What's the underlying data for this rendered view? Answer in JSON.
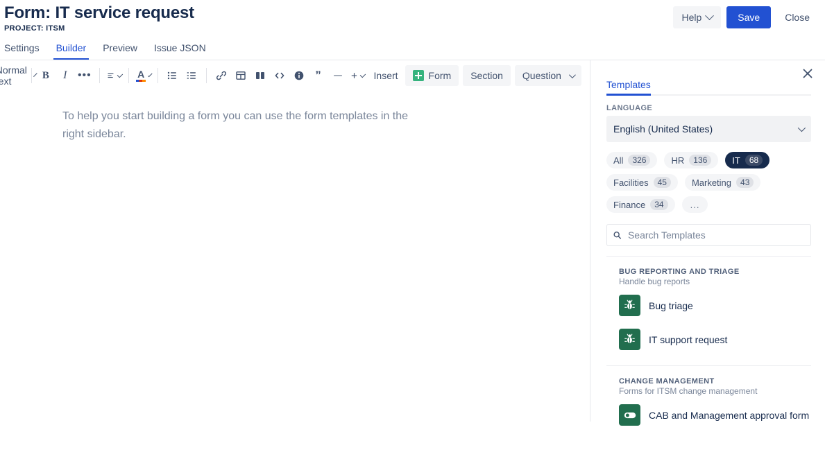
{
  "header": {
    "title": "Form: IT service request",
    "project": "PROJECT: ITSM",
    "help_label": "Help",
    "save_label": "Save",
    "close_label": "Close",
    "primary_color": "#2251d2"
  },
  "main_tabs": [
    {
      "label": "Settings",
      "active": false
    },
    {
      "label": "Builder",
      "active": true
    },
    {
      "label": "Preview",
      "active": false
    },
    {
      "label": "Issue JSON",
      "active": false
    }
  ],
  "toolbar": {
    "text_style": "Normal text",
    "bold": "B",
    "italic": "I",
    "more_marks": "•••",
    "align": "align-left",
    "text_color_glyph": "A",
    "bullet_list": "bullet-list",
    "numbered_list": "numbered-list",
    "link": "link",
    "table": "table",
    "layout": "columns-layout",
    "code": "code-snippet",
    "info_panel": "info-panel",
    "quote": "”",
    "divider": "—",
    "plus": "+",
    "insert_label": "Insert",
    "form_label": "Form",
    "section_label": "Section",
    "question_label": "Question"
  },
  "editor": {
    "paragraph": "To help you start building a form you can use the form templates in the right sidebar."
  },
  "sidebar": {
    "close_icon": "close-icon",
    "tab_label": "Templates",
    "language_label": "LANGUAGE",
    "language_value": "English (United States)",
    "chips": [
      {
        "label": "All",
        "count": "326",
        "selected": false
      },
      {
        "label": "HR",
        "count": "136",
        "selected": false
      },
      {
        "label": "IT",
        "count": "68",
        "selected": true
      },
      {
        "label": "Facilities",
        "count": "45",
        "selected": false
      },
      {
        "label": "Marketing",
        "count": "43",
        "selected": false
      },
      {
        "label": "Finance",
        "count": "34",
        "selected": false
      },
      {
        "label": "...",
        "count": "",
        "selected": false
      }
    ],
    "search_placeholder": "Search Templates",
    "search_value": "",
    "groups": [
      {
        "title": "BUG REPORTING AND TRIAGE",
        "subtitle": "Handle bug reports",
        "items": [
          {
            "name": "Bug triage",
            "icon": "bug-icon"
          },
          {
            "name": "IT support request",
            "icon": "bug-icon"
          }
        ]
      },
      {
        "title": "CHANGE MANAGEMENT",
        "subtitle": "Forms for ITSM change management",
        "items": [
          {
            "name": "CAB and Management approval form",
            "icon": "toggle-icon"
          }
        ]
      }
    ]
  }
}
